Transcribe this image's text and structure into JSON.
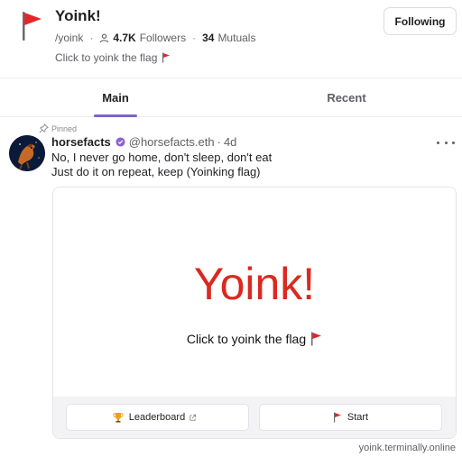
{
  "header": {
    "title": "Yoink!",
    "handle": "/yoink",
    "followers_count": "4.7K",
    "followers_label": "Followers",
    "mutuals_count": "34",
    "mutuals_label": "Mutuals",
    "description": "Click to yoink the flag",
    "follow_button": "Following",
    "icon": "red-flag-icon"
  },
  "tabs": [
    {
      "label": "Main",
      "active": true
    },
    {
      "label": "Recent",
      "active": false
    }
  ],
  "cast": {
    "pinned_label": "Pinned",
    "author_name": "horsefacts",
    "author_handle": "@horsefacts.eth",
    "separator": "·",
    "time": "4d",
    "text_line1": "No, I never go home, don't sleep, don't eat",
    "text_line2": "Just do it on repeat, keep (Yoinking flag)",
    "verified_icon": "verified-badge-icon"
  },
  "frame": {
    "heading": "Yoink!",
    "subtext": "Click to yoink the flag",
    "buttons": [
      {
        "label": "Leaderboard",
        "icon": "trophy-icon",
        "external": true
      },
      {
        "label": "Start",
        "icon": "red-flag-icon",
        "external": false
      }
    ],
    "domain": "yoink.terminally.online"
  },
  "colors": {
    "accent": "#7c65c1",
    "flag_red": "#d92a20",
    "text_primary": "#1f1f23",
    "text_secondary": "#5f5f66"
  }
}
